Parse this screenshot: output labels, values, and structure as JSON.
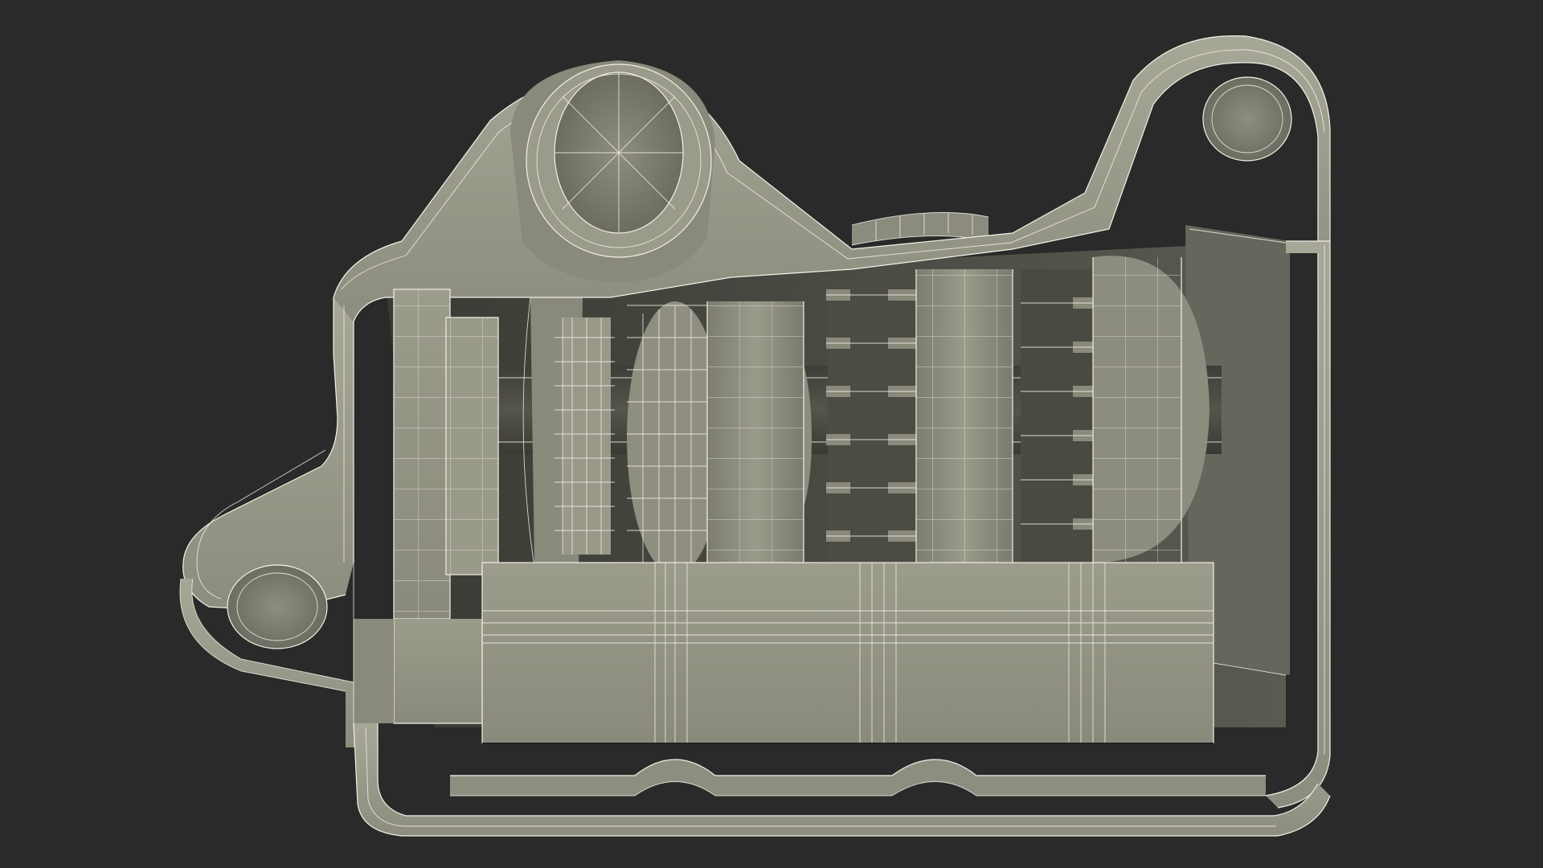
{
  "scene": {
    "background_color": "#2a2a2a",
    "surface_color": "#9a9a8a",
    "surface_shadow_color": "#5e5e54",
    "wire_color": "#f3f1e6"
  }
}
